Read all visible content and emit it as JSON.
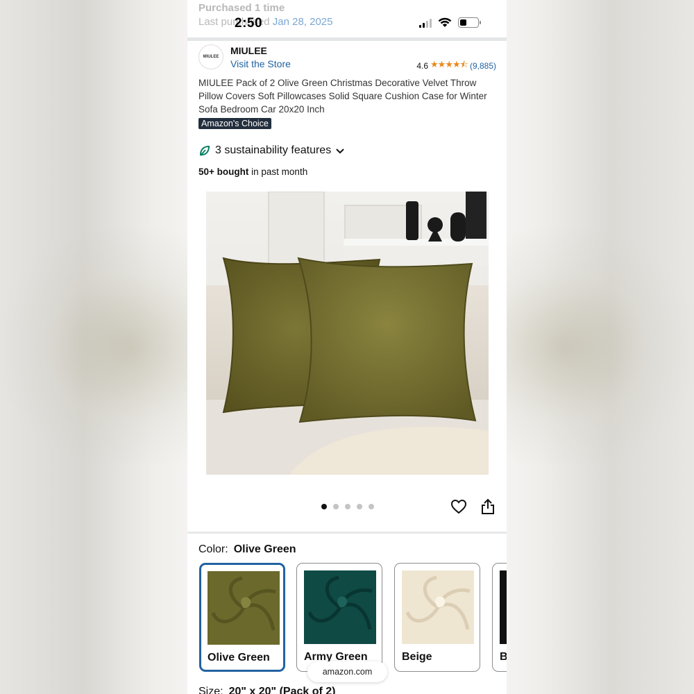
{
  "purchase": {
    "line1": "Purchased 1 time",
    "line2_prefix": "Last purchased",
    "line2_date": "Jan 28, 2025"
  },
  "status_bar": {
    "time": "2:50"
  },
  "brand": {
    "logo_text": "MIULEE",
    "name": "MIULEE",
    "visit_store": "Visit the Store"
  },
  "rating": {
    "value": "4.6",
    "stars": "★★★★⯪",
    "count": "(9,885)",
    "star_color": "#e8891d"
  },
  "product": {
    "title": "MIULEE Pack of 2 Olive Green Christmas Decorative Velvet Throw Pillow Covers Soft Pillowcases Solid Square Cushion Case for Winter Sofa Bedroom Car 20x20 Inch",
    "badge": "Amazon's Choice",
    "sustainability": "3 sustainability features",
    "bought_bold": "50+ bought",
    "bought_rest": "in past month"
  },
  "gallery": {
    "image_count": 5,
    "active_index": 0
  },
  "color": {
    "label": "Color:",
    "selected": "Olive Green",
    "options": [
      {
        "name": "Olive Green",
        "hex": "#6b6a2c"
      },
      {
        "name": "Army Green",
        "hex": "#0f4a45"
      },
      {
        "name": "Beige",
        "hex": "#efe6d2"
      },
      {
        "name": "B",
        "hex": "#111111"
      }
    ]
  },
  "overlay": {
    "domain": "amazon.com"
  },
  "size": {
    "label": "Size:",
    "value": "20\" x 20\" (Pack of 2)"
  },
  "colors": {
    "link": "#2162a1",
    "badge_bg": "#232f3e",
    "leaf": "#067d62"
  }
}
